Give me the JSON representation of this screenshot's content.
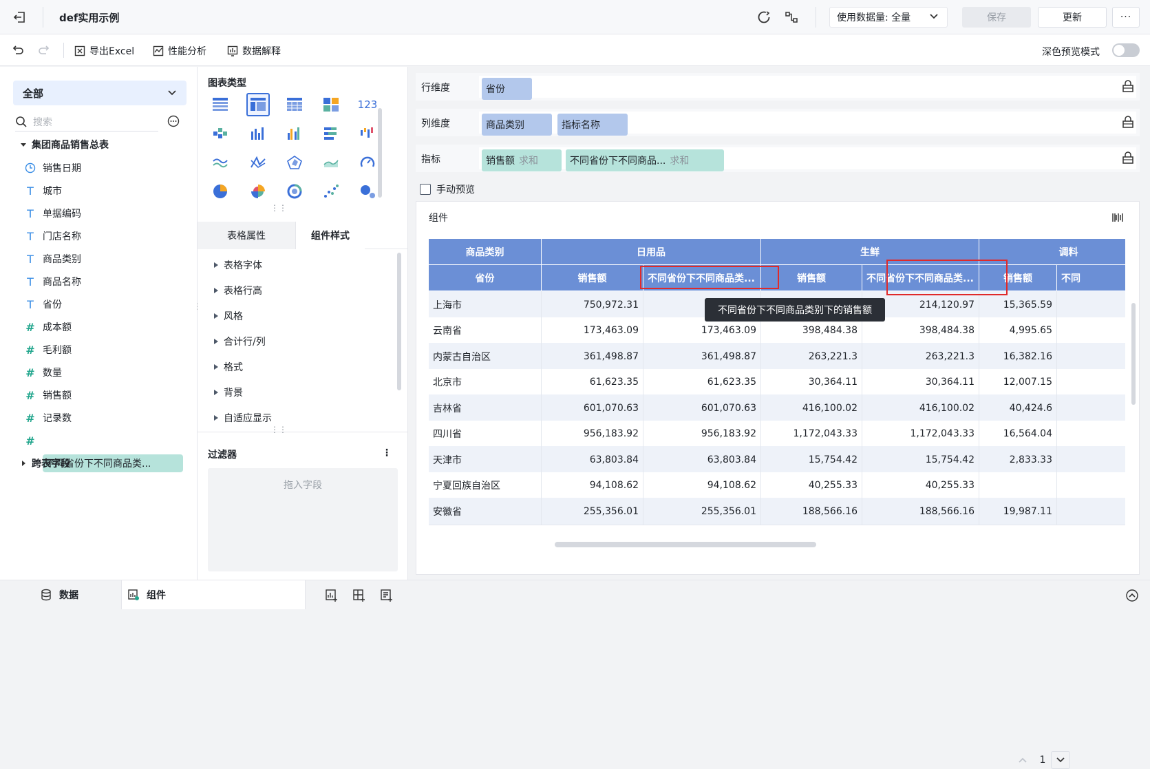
{
  "app": {
    "title": "def实用示例",
    "data_usage_label": "使用数据量: 全量",
    "save_label": "保存",
    "update_label": "更新",
    "more_label": "···"
  },
  "toolbar": {
    "export_excel": "导出Excel",
    "perf_analysis": "性能分析",
    "data_explain": "数据解释",
    "dark_preview": "深色预览模式"
  },
  "left": {
    "scope": "全部",
    "search_placeholder": "搜索",
    "table_group": "集团商品销售总表",
    "fields": [
      {
        "label": "销售日期",
        "icon": "clock-icon"
      },
      {
        "label": "城市",
        "icon": "text-type-icon"
      },
      {
        "label": "单据编码",
        "icon": "text-type-icon"
      },
      {
        "label": "门店名称",
        "icon": "text-type-icon"
      },
      {
        "label": "商品类别",
        "icon": "text-type-icon"
      },
      {
        "label": "商品名称",
        "icon": "text-type-icon"
      },
      {
        "label": "省份",
        "icon": "text-type-icon"
      },
      {
        "label": "成本额",
        "icon": "number-type-icon"
      },
      {
        "label": "毛利额",
        "icon": "number-type-icon"
      },
      {
        "label": "数量",
        "icon": "number-type-icon"
      },
      {
        "label": "销售额",
        "icon": "number-type-icon"
      },
      {
        "label": "记录数",
        "icon": "number-type-icon"
      }
    ],
    "calc_field": "不同省份下不同商品类...",
    "cross_table": "跨表字段"
  },
  "middle": {
    "chart_type_title": "图表类型",
    "tab_table_props": "表格属性",
    "tab_component_style": "组件样式",
    "props": [
      "表格字体",
      "表格行高",
      "风格",
      "合计行/列",
      "格式",
      "背景",
      "自适应显示"
    ],
    "filter_title": "过滤器",
    "drop_hint": "拖入字段",
    "number_icon_text": "123"
  },
  "config": {
    "row_dim_label": "行维度",
    "col_dim_label": "列维度",
    "metric_label": "指标",
    "row_chips": [
      "省份"
    ],
    "col_chips": [
      "商品类别",
      "指标名称"
    ],
    "metric_chips": [
      {
        "name": "销售额",
        "agg": "求和"
      },
      {
        "name": "不同省份下不同商品...",
        "agg": "求和"
      }
    ],
    "manual_preview": "手动预览"
  },
  "component": {
    "title": "组件",
    "header_row1": [
      "商品类别",
      "日用品",
      "生鲜",
      "调料"
    ],
    "header_row2": [
      "省份",
      "销售额",
      "不同省份下不同商品类...",
      "销售额",
      "不同省份下不同商品类...",
      "销售额",
      "不同"
    ],
    "tooltip": "不同省份下不同商品类别下的销售额",
    "rows": [
      [
        "上海市",
        "750,972.31",
        "",
        "",
        "214,120.97",
        "15,365.59"
      ],
      [
        "云南省",
        "173,463.09",
        "173,463.09",
        "398,484.38",
        "398,484.38",
        "4,995.65"
      ],
      [
        "内蒙古自治区",
        "361,498.87",
        "361,498.87",
        "263,221.3",
        "263,221.3",
        "16,382.16"
      ],
      [
        "北京市",
        "61,623.35",
        "61,623.35",
        "30,364.11",
        "30,364.11",
        "12,007.15"
      ],
      [
        "吉林省",
        "601,070.63",
        "601,070.63",
        "416,100.02",
        "416,100.02",
        "40,424.6"
      ],
      [
        "四川省",
        "956,183.92",
        "956,183.92",
        "1,172,043.33",
        "1,172,043.33",
        "16,564.04"
      ],
      [
        "天津市",
        "63,803.84",
        "63,803.84",
        "15,754.42",
        "15,754.42",
        "2,833.33"
      ],
      [
        "宁夏回族自治区",
        "94,108.62",
        "94,108.62",
        "40,255.33",
        "40,255.33",
        ""
      ],
      [
        "安徽省",
        "255,356.01",
        "255,356.01",
        "188,566.16",
        "188,566.16",
        "19,987.11"
      ]
    ],
    "page": "1"
  },
  "bottom": {
    "tab_data": "数据",
    "tab_component": "组件"
  }
}
